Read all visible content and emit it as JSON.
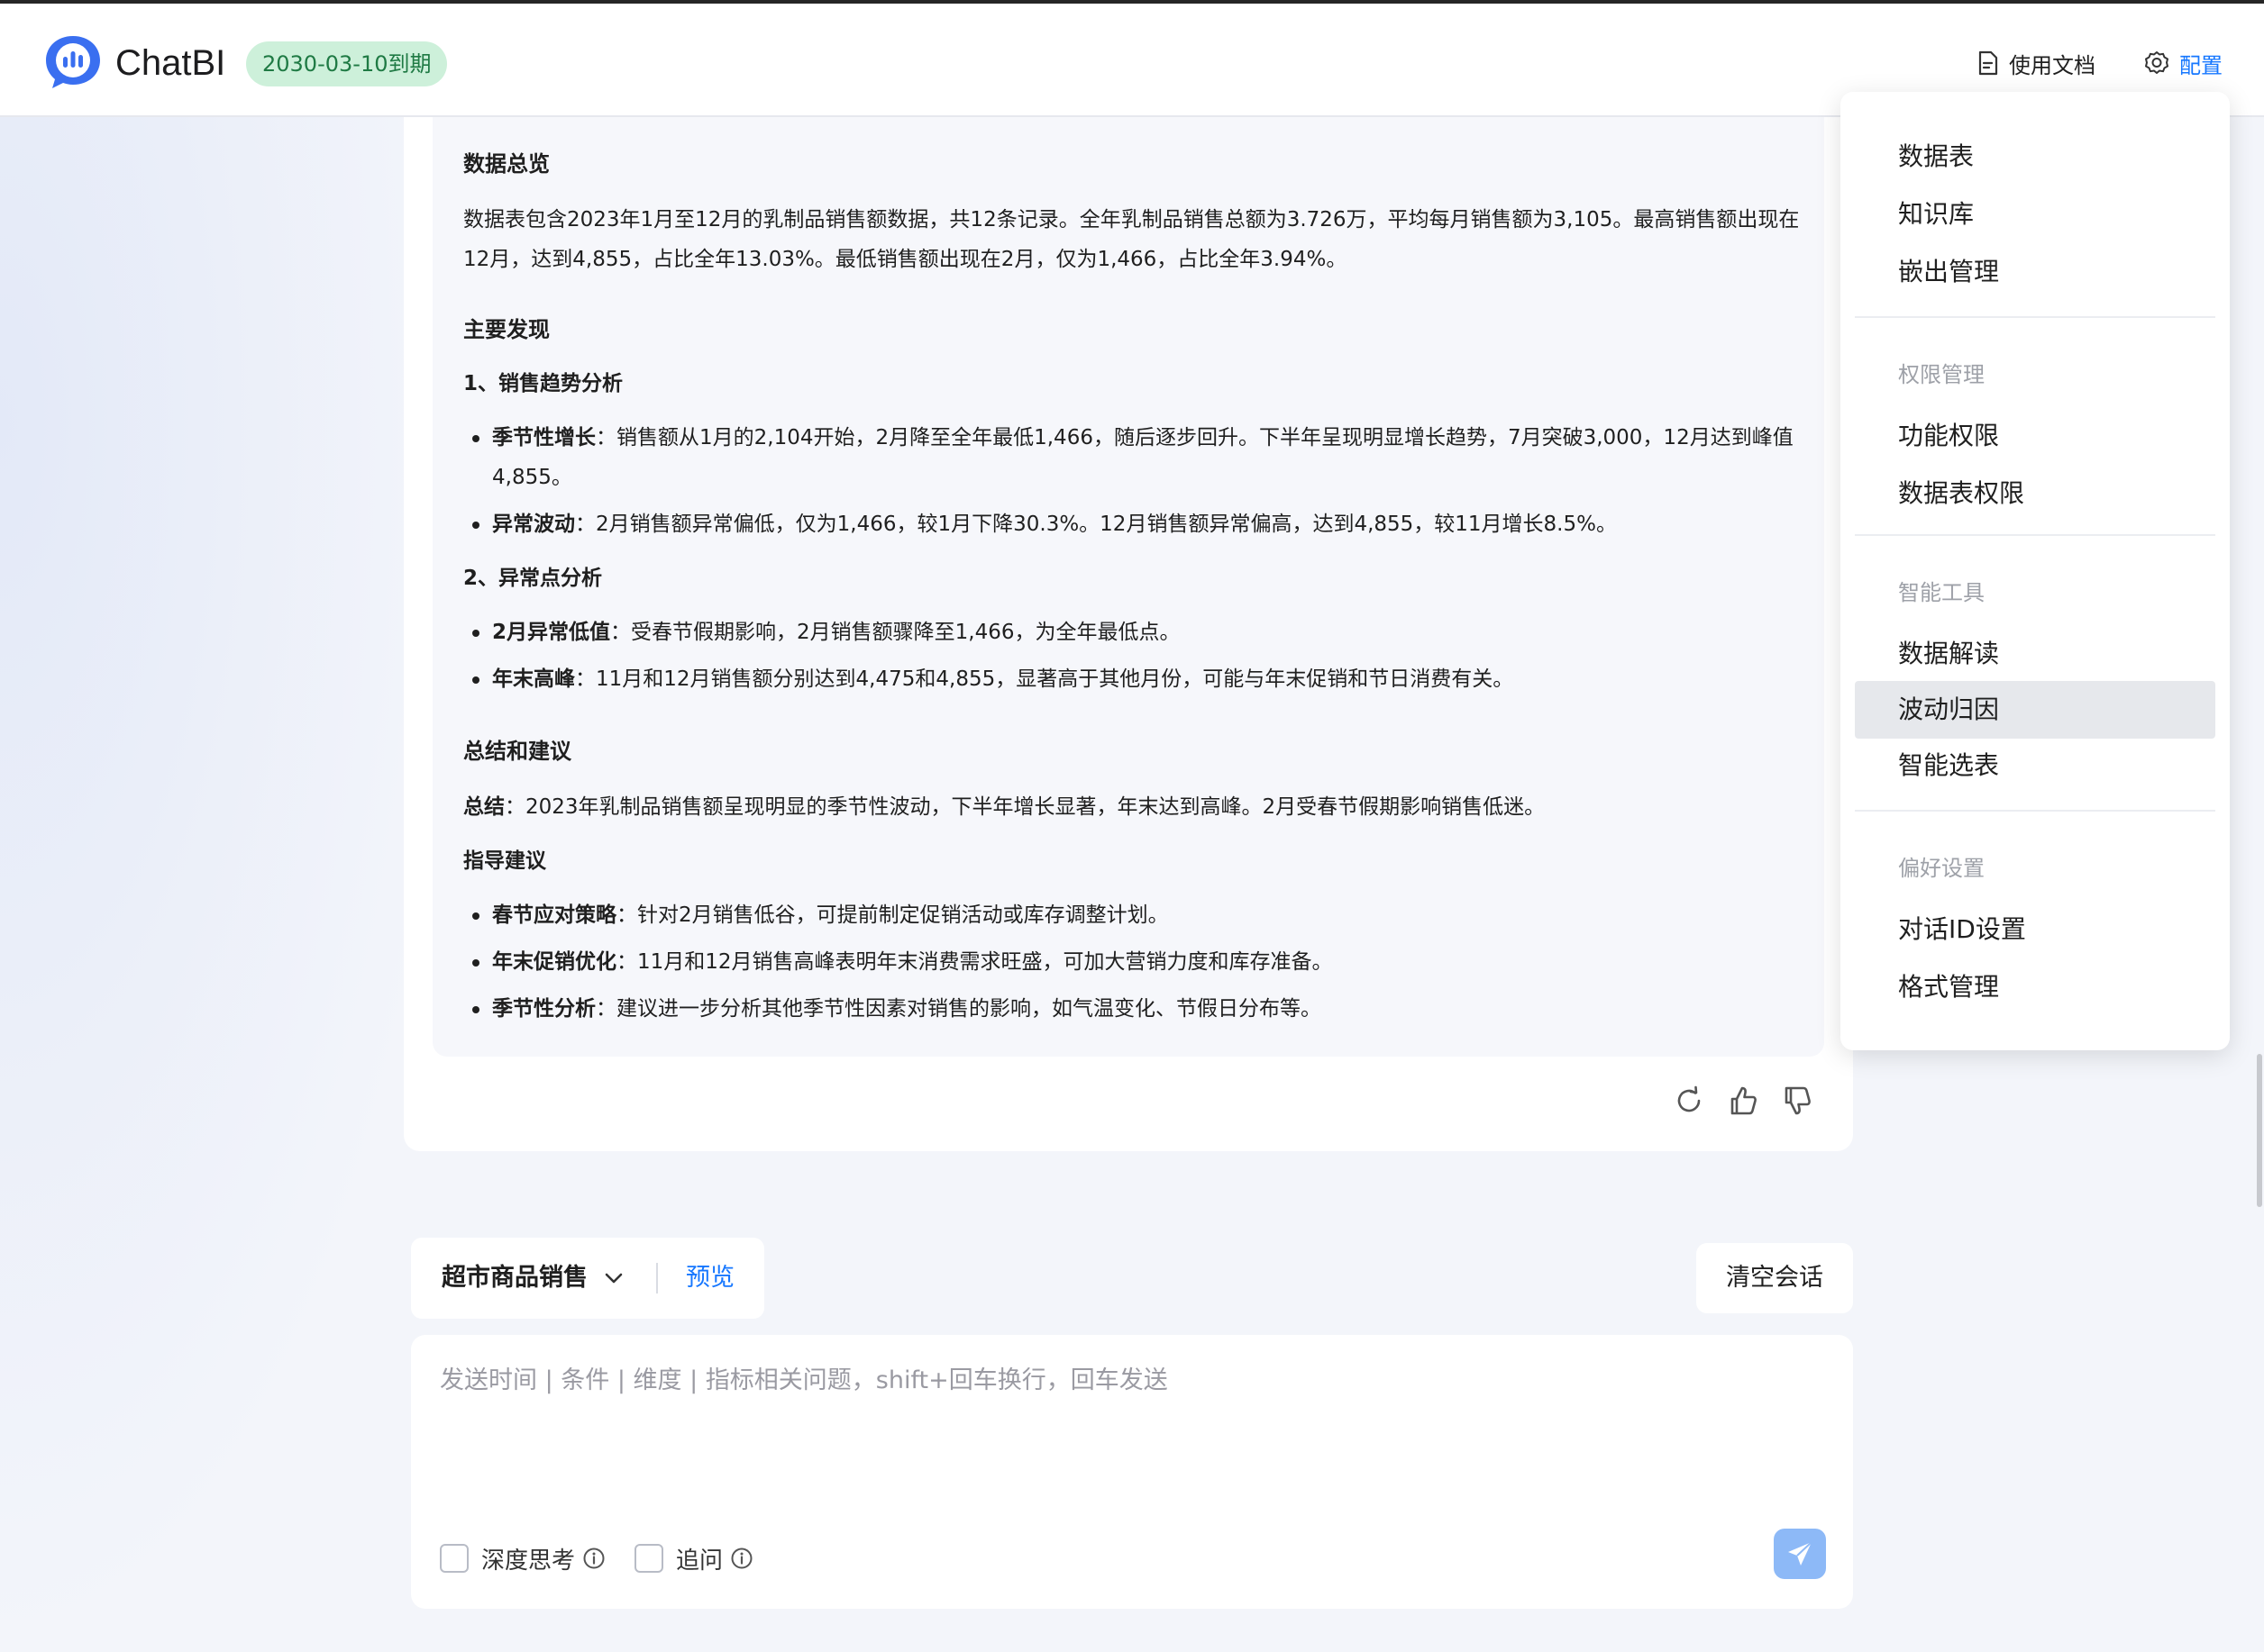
{
  "header": {
    "brand": "ChatBI",
    "expiry": "2030-03-10到期",
    "docs_label": "使用文档",
    "config_label": "配置"
  },
  "answer": {
    "overview_title": "数据总览",
    "overview_text": "数据表包含2023年1月至12月的乳制品销售额数据，共12条记录。全年乳制品销售总额为3.726万，平均每月销售额为3,105。最高销售额出现在12月，达到4,855，占比全年13.03%。最低销售额出现在2月，仅为1,466，占比全年3.94%。",
    "findings_title": "主要发现",
    "trend_title": "1、销售趋势分析",
    "trend_items": [
      {
        "label": "季节性增长",
        "text": "：销售额从1月的2,104开始，2月降至全年最低1,466，随后逐步回升。下半年呈现明显增长趋势，7月突破3,000，12月达到峰值4,855。"
      },
      {
        "label": "异常波动",
        "text": "：2月销售额异常偏低，仅为1,466，较1月下降30.3%。12月销售额异常偏高，达到4,855，较11月增长8.5%。"
      }
    ],
    "anomaly_title": "2、异常点分析",
    "anomaly_items": [
      {
        "label": "2月异常低值",
        "text": "：受春节假期影响，2月销售额骤降至1,466，为全年最低点。"
      },
      {
        "label": "年末高峰",
        "text": "：11月和12月销售额分别达到4,475和4,855，显著高于其他月份，可能与年末促销和节日消费有关。"
      }
    ],
    "summary_title": "总结和建议",
    "summary_label": "总结",
    "summary_text": "：2023年乳制品销售额呈现明显的季节性波动，下半年增长显著，年末达到高峰。2月受春节假期影响销售低迷。",
    "advice_title": "指导建议",
    "advice_items": [
      {
        "label": "春节应对策略",
        "text": "：针对2月销售低谷，可提前制定促销活动或库存调整计划。"
      },
      {
        "label": "年末促销优化",
        "text": "：11月和12月销售高峰表明年末消费需求旺盛，可加大营销力度和库存准备。"
      },
      {
        "label": "季节性分析",
        "text": "：建议进一步分析其他季节性因素对销售的影响，如气温变化、节假日分布等。"
      }
    ]
  },
  "dataset": {
    "name": "超市商品销售",
    "preview_label": "预览"
  },
  "clear_label": "清空会话",
  "input": {
    "placeholder": "发送时间 | 条件 | 维度 | 指标相关问题，shift+回车换行，回车发送",
    "value": "",
    "deep_think_label": "深度思考",
    "follow_up_label": "追问"
  },
  "menu": {
    "items_top": [
      "数据表",
      "知识库",
      "嵌出管理"
    ],
    "group_permissions": "权限管理",
    "items_permissions": [
      "功能权限",
      "数据表权限"
    ],
    "group_tools": "智能工具",
    "items_tools": [
      "数据解读",
      "波动归因",
      "智能选表"
    ],
    "active_item": "波动归因",
    "group_preferences": "偏好设置",
    "items_preferences": [
      "对话ID设置",
      "格式管理"
    ]
  },
  "colors": {
    "accent": "#1677ff",
    "expiry_bg": "#cdf0da",
    "expiry_text": "#1f7a44",
    "send_button": "#8db9f7"
  }
}
